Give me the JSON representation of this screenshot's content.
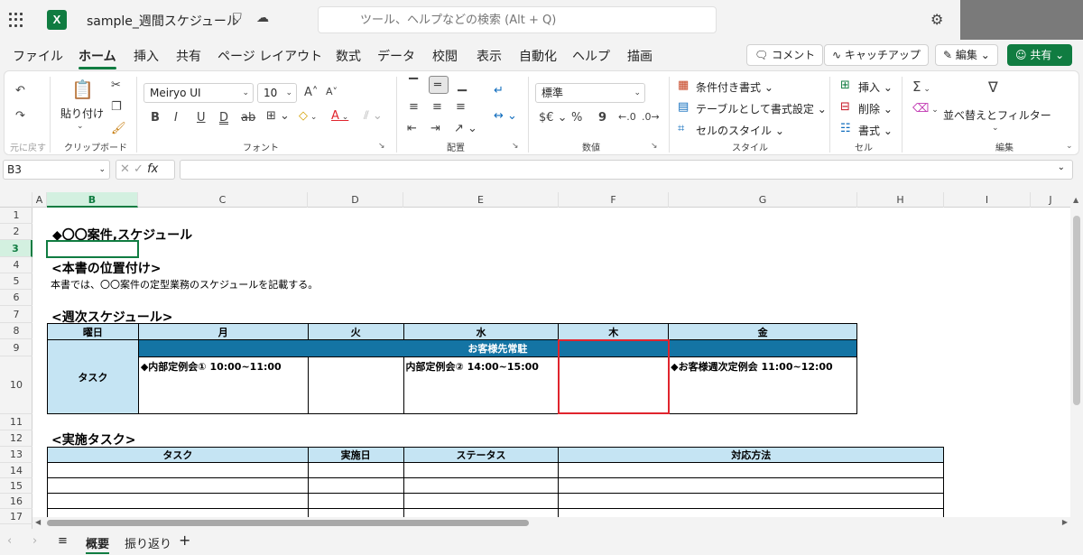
{
  "title_bar": {
    "app_icon": "X",
    "document_title": "sample_週間スケジュール",
    "search_placeholder": "ツール、ヘルプなどの検索 (Alt + Q)"
  },
  "ribbon_tabs": [
    "ファイル",
    "ホーム",
    "挿入",
    "共有",
    "ページ レイアウト",
    "数式",
    "データ",
    "校閲",
    "表示",
    "自動化",
    "ヘルプ",
    "描画"
  ],
  "active_tab": "ホーム",
  "ribbon_actions": {
    "comment": "コメント",
    "catchup": "キャッチアップ",
    "edit": "編集",
    "share": "共有"
  },
  "ribbon": {
    "undo_group_label": "元に戻す",
    "paste_label": "貼り付け",
    "clipboard_label": "クリップボード",
    "font_name": "Meiryo UI",
    "font_size": "10",
    "font_label": "フォント",
    "alignment_label": "配置",
    "number_format": "標準",
    "number_label": "数値",
    "number_currency": "$€",
    "number_percent": "%",
    "number_comma": "9",
    "conditional_format": "条件付き書式",
    "table_format": "テーブルとして書式設定",
    "cell_styles": "セルのスタイル",
    "styles_label": "スタイル",
    "insert": "挿入",
    "delete": "削除",
    "format": "書式",
    "cells_label": "セル",
    "sum_symbol": "Σ",
    "sort_filter": "並べ替えとフィルター",
    "editing_label": "編集"
  },
  "formula_bar": {
    "name_box": "B3",
    "fx": "fx",
    "value": ""
  },
  "columns": [
    "A",
    "B",
    "C",
    "D",
    "E",
    "F",
    "G",
    "H",
    "I",
    "J"
  ],
  "selected_column": "B",
  "rows": [
    "1",
    "2",
    "3",
    "4",
    "5",
    "6",
    "7",
    "8",
    "9",
    "10",
    "11",
    "12",
    "13",
    "14",
    "15",
    "16",
    "17"
  ],
  "selected_row": "3",
  "sheet": {
    "title": "◆〇〇案件,スケジュール",
    "position_heading": "<本書の位置付け>",
    "position_text": "本書では、〇〇案件の定型業務のスケジュールを記載する。",
    "weekly_heading": "<週次スケジュール>",
    "weekly_table": {
      "header": [
        "曜日",
        "月",
        "火",
        "水",
        "木",
        "金"
      ],
      "task_label": "タスク",
      "banner": "お客様先常駐",
      "entries": {
        "mon": "◆内部定例会①  10:00~11:00",
        "tue": "",
        "wed": "内部定例会②  14:00~15:00",
        "thu": "",
        "fri": "◆お客様週次定例会  11:00~12:00"
      }
    },
    "tasks_heading": "<実施タスク>",
    "tasks_table": {
      "header": [
        "タスク",
        "実施日",
        "ステータス",
        "対応方法"
      ]
    }
  },
  "sheet_tabs": [
    "概要",
    "振り返り"
  ],
  "active_sheet": "概要",
  "colors": {
    "accent": "#107c41",
    "header_fill": "#c5e4f3",
    "banner_fill": "#1474a4",
    "highlight_border": "#e0242d"
  }
}
